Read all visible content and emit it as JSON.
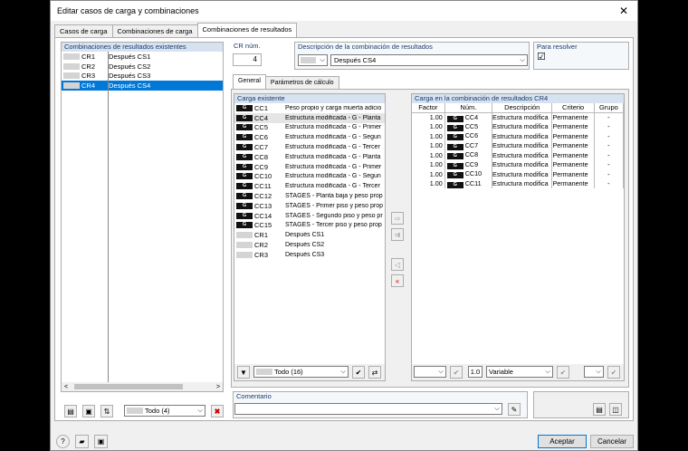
{
  "window": {
    "title": "Editar casos de carga y combinaciones"
  },
  "tabs": [
    "Casos de carga",
    "Combinaciones de carga",
    "Combinaciones de resultados"
  ],
  "left": {
    "header": "Combinaciones de resultados existentes",
    "items": [
      {
        "id": "CR1",
        "desc": "Después CS1"
      },
      {
        "id": "CR2",
        "desc": "Después CS2"
      },
      {
        "id": "CR3",
        "desc": "Después CS3"
      },
      {
        "id": "CR4",
        "desc": "Después CS4"
      }
    ],
    "filter": "Todo (4)"
  },
  "top": {
    "cr_label": "CR núm.",
    "cr_value": "4",
    "desc_label": "Descripción de la combinación de resultados",
    "desc_value": "Después CS4",
    "resolve_label": "Para resolver",
    "resolve_check": "☑"
  },
  "subtabs": [
    "General",
    "Parámetros de cálculo"
  ],
  "existing": {
    "header": "Carga existente",
    "items": [
      {
        "tag": "G",
        "id": "CC1",
        "desc": "Peso propio y carga muerta adicio"
      },
      {
        "tag": "G",
        "id": "CC4",
        "desc": "Estructura modificada - G - Planta"
      },
      {
        "tag": "G",
        "id": "CC5",
        "desc": "Estructura modificada - G - Primer"
      },
      {
        "tag": "G",
        "id": "CC6",
        "desc": "Estructura modificada - G - Segun"
      },
      {
        "tag": "G",
        "id": "CC7",
        "desc": "Estructura modificada - G - Tercer"
      },
      {
        "tag": "G",
        "id": "CC8",
        "desc": "Estructura modificada - G - Planta"
      },
      {
        "tag": "G",
        "id": "CC9",
        "desc": "Estructura modificada - G - Primer"
      },
      {
        "tag": "G",
        "id": "CC10",
        "desc": "Estructura modificada - G - Segun"
      },
      {
        "tag": "G",
        "id": "CC11",
        "desc": "Estructura modificada - G - Tercer"
      },
      {
        "tag": "G",
        "id": "CC12",
        "desc": "STAGES - Planta baja y peso prop"
      },
      {
        "tag": "G",
        "id": "CC13",
        "desc": "STAGES - Primer piso y peso propi"
      },
      {
        "tag": "G",
        "id": "CC14",
        "desc": "STAGES - Segundo piso y peso pr"
      },
      {
        "tag": "G",
        "id": "CC15",
        "desc": "STAGES - Tercer piso y peso prop"
      },
      {
        "tag": "",
        "id": "CR1",
        "desc": "Después CS1"
      },
      {
        "tag": "",
        "id": "CR2",
        "desc": "Después CS2"
      },
      {
        "tag": "",
        "id": "CR3",
        "desc": "Después CS3"
      }
    ],
    "filter": "Todo (16)"
  },
  "combo": {
    "header": "Carga en la combinación de resultados CR4",
    "columns": [
      "Factor",
      "Núm.",
      "Descripción",
      "Criterio",
      "Grupo"
    ],
    "rows": [
      {
        "factor": "1.00",
        "tag": "G",
        "id": "CC4",
        "desc": "Estructura modifica",
        "crit": "Permanente",
        "group": "-"
      },
      {
        "factor": "1.00",
        "tag": "G",
        "id": "CC5",
        "desc": "Estructura modifica",
        "crit": "Permanente",
        "group": "-"
      },
      {
        "factor": "1.00",
        "tag": "G",
        "id": "CC6",
        "desc": "Estructura modifica",
        "crit": "Permanente",
        "group": "-"
      },
      {
        "factor": "1.00",
        "tag": "G",
        "id": "CC7",
        "desc": "Estructura modifica",
        "crit": "Permanente",
        "group": "-"
      },
      {
        "factor": "1.00",
        "tag": "G",
        "id": "CC8",
        "desc": "Estructura modifica",
        "crit": "Permanente",
        "group": "-"
      },
      {
        "factor": "1.00",
        "tag": "G",
        "id": "CC9",
        "desc": "Estructura modifica",
        "crit": "Permanente",
        "group": "-"
      },
      {
        "factor": "1.00",
        "tag": "G",
        "id": "CC10",
        "desc": "Estructura modifica",
        "crit": "Permanente",
        "group": "-"
      },
      {
        "factor": "1.00",
        "tag": "G",
        "id": "CC11",
        "desc": "Estructura modifica",
        "crit": "Permanente",
        "group": "-"
      }
    ],
    "factor_value": "1.0",
    "criterion_value": "Variable"
  },
  "comment_label": "Comentario",
  "buttons": {
    "accept": "Aceptar",
    "cancel": "Cancelar"
  }
}
